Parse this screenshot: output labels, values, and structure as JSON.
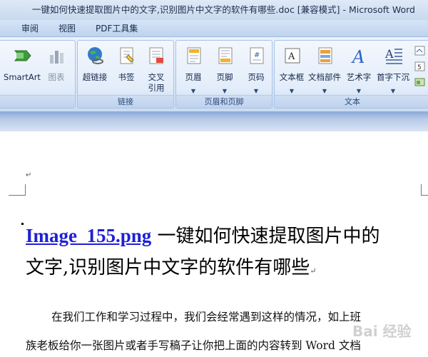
{
  "window": {
    "title": "一键如何快速提取图片中的文字,识别图片中文字的软件有哪些.doc [兼容模式] - Microsoft Word"
  },
  "menu": {
    "items": [
      "审阅",
      "视图",
      "PDF工具集"
    ]
  },
  "ribbon": {
    "groups": [
      {
        "label": "",
        "buttons": [
          "SmartArt",
          "图表"
        ]
      },
      {
        "label": "链接",
        "buttons": [
          "超链接",
          "书签",
          "交叉\n引用"
        ]
      },
      {
        "label": "页眉和页脚",
        "buttons": [
          "页眉",
          "页脚",
          "页码"
        ]
      },
      {
        "label": "文本",
        "buttons": [
          "文本框",
          "文档部件",
          "艺术字",
          "首字下沉"
        ]
      }
    ]
  },
  "document": {
    "paragraph_mark": "↵",
    "heading_link": "Image_155.png",
    "heading_line1_rest": " 一键如何快速提取图片中的",
    "heading_line2": "文字,识别图片中文字的软件有哪些",
    "body_line1": "在我们工作和学习过程中，我们会经常遇到这样的情况，如上班",
    "body_line2": "族老板给你一张图片或者手写稿子让你把上面的内容转到 Word 文档"
  },
  "watermark": "Bai 经验"
}
